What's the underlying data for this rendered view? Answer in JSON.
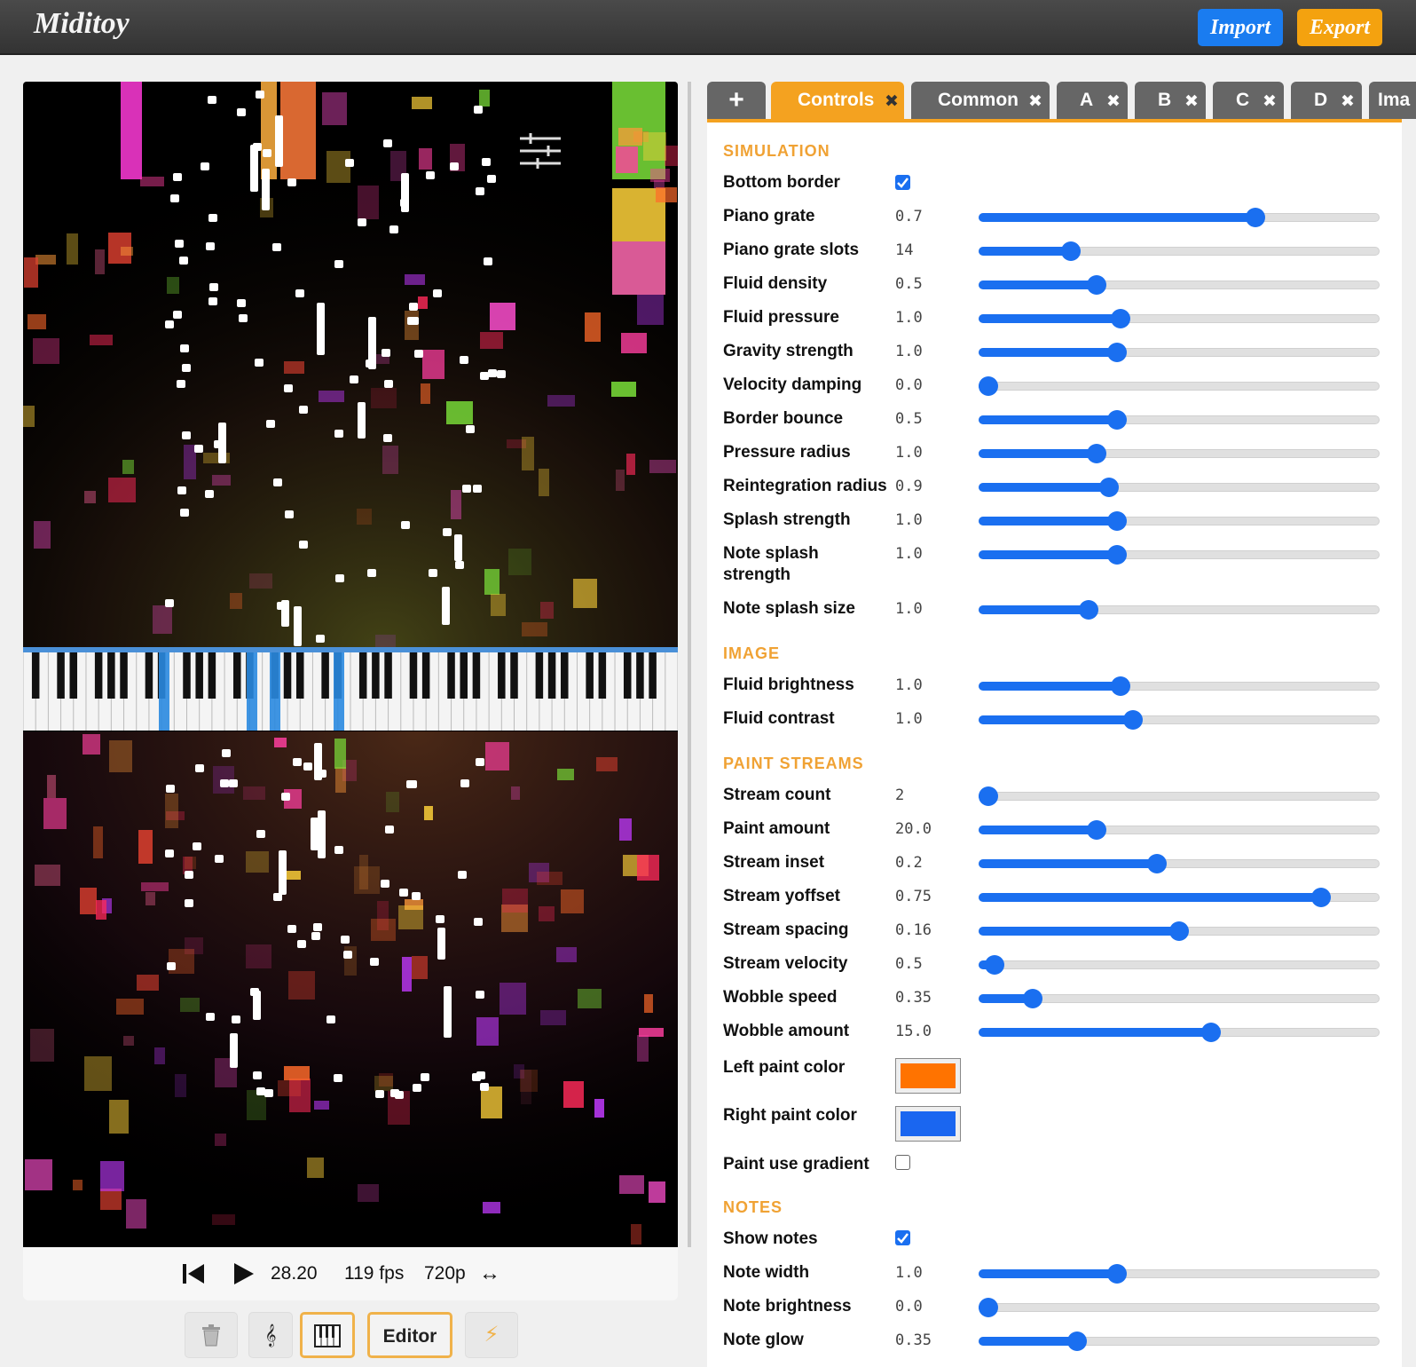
{
  "app": {
    "title": "Miditoy"
  },
  "header": {
    "import_label": "Import",
    "export_label": "Export"
  },
  "transport": {
    "time": "28.20",
    "fps": "119 fps",
    "resolution": "720p",
    "expand_glyph": "↔"
  },
  "tools": {
    "editor_label": "Editor"
  },
  "tabs": [
    {
      "label": "+"
    },
    {
      "label": "Controls",
      "closable": true,
      "active": true
    },
    {
      "label": "Common",
      "closable": true
    },
    {
      "label": "A",
      "closable": true
    },
    {
      "label": "B",
      "closable": true
    },
    {
      "label": "C",
      "closable": true
    },
    {
      "label": "D",
      "closable": true
    },
    {
      "label": "Ima"
    }
  ],
  "colors": {
    "accent": "#f4a220",
    "slider": "#1a6ff0",
    "import": "#1a7cf0",
    "export": "#f4a20f",
    "left_paint": "#ff7300",
    "right_paint": "#1a66f0"
  },
  "controls": {
    "simulation": {
      "title": "SIMULATION",
      "bottom_border": {
        "label": "Bottom border",
        "checked": true
      },
      "rows": [
        {
          "label": "Piano grate",
          "value": "0.7",
          "fraction": 0.69
        },
        {
          "label": "Piano grate slots",
          "value": "14",
          "fraction": 0.23
        },
        {
          "label": "Fluid density",
          "value": "0.5",
          "fraction": 0.295
        },
        {
          "label": "Fluid pressure",
          "value": "1.0",
          "fraction": 0.355
        },
        {
          "label": "Gravity strength",
          "value": "1.0",
          "fraction": 0.345
        },
        {
          "label": "Velocity damping",
          "value": "0.0",
          "fraction": 0.025
        },
        {
          "label": "Border bounce",
          "value": "0.5",
          "fraction": 0.345
        },
        {
          "label": "Pressure radius",
          "value": "1.0",
          "fraction": 0.295
        },
        {
          "label": "Reintegration radius",
          "value": "0.9",
          "fraction": 0.325
        },
        {
          "label": "Splash strength",
          "value": "1.0",
          "fraction": 0.345
        },
        {
          "label": "Note splash strength",
          "value": "1.0",
          "fraction": 0.345
        },
        {
          "label": "Note splash size",
          "value": "1.0",
          "fraction": 0.275
        }
      ]
    },
    "image": {
      "title": "IMAGE",
      "rows": [
        {
          "label": "Fluid brightness",
          "value": "1.0",
          "fraction": 0.355
        },
        {
          "label": "Fluid contrast",
          "value": "1.0",
          "fraction": 0.385
        }
      ]
    },
    "paint_streams": {
      "title": "PAINT STREAMS",
      "rows": [
        {
          "label": "Stream count",
          "value": "2",
          "fraction": 0.025
        },
        {
          "label": "Paint amount",
          "value": "20.0",
          "fraction": 0.295
        },
        {
          "label": "Stream inset",
          "value": "0.2",
          "fraction": 0.445
        },
        {
          "label": "Stream yoffset",
          "value": "0.75",
          "fraction": 0.855
        },
        {
          "label": "Stream spacing",
          "value": "0.16",
          "fraction": 0.5
        },
        {
          "label": "Stream velocity",
          "value": "0.5",
          "fraction": 0.04
        },
        {
          "label": "Wobble speed",
          "value": "0.35",
          "fraction": 0.135
        },
        {
          "label": "Wobble amount",
          "value": "15.0",
          "fraction": 0.58
        }
      ],
      "left_color_label": "Left paint color",
      "right_color_label": "Right paint color",
      "gradient": {
        "label": "Paint use gradient",
        "checked": false
      }
    },
    "notes": {
      "title": "NOTES",
      "show_notes": {
        "label": "Show notes",
        "checked": true
      },
      "rows": [
        {
          "label": "Note width",
          "value": "1.0",
          "fraction": 0.345
        },
        {
          "label": "Note brightness",
          "value": "0.0",
          "fraction": 0.025
        },
        {
          "label": "Note glow",
          "value": "0.35",
          "fraction": 0.245
        }
      ]
    }
  }
}
